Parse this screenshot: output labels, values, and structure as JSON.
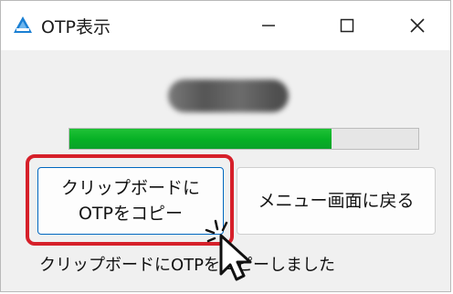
{
  "window": {
    "title": "OTP表示",
    "controls": {
      "minimize_icon": "minimize-icon",
      "maximize_icon": "maximize-icon",
      "close_icon": "close-icon"
    }
  },
  "otp": {
    "value_masked": true
  },
  "progress": {
    "fraction": 0.75,
    "color": "#06b025"
  },
  "buttons": {
    "copy_line1": "クリップボードに",
    "copy_line2": "OTPをコピー",
    "menu_label": "メニュー画面に戻る"
  },
  "status": {
    "text": "クリップボードにOTPをコピーしました"
  },
  "colors": {
    "highlight": "#d6202a",
    "focus_border": "#0067c0"
  }
}
